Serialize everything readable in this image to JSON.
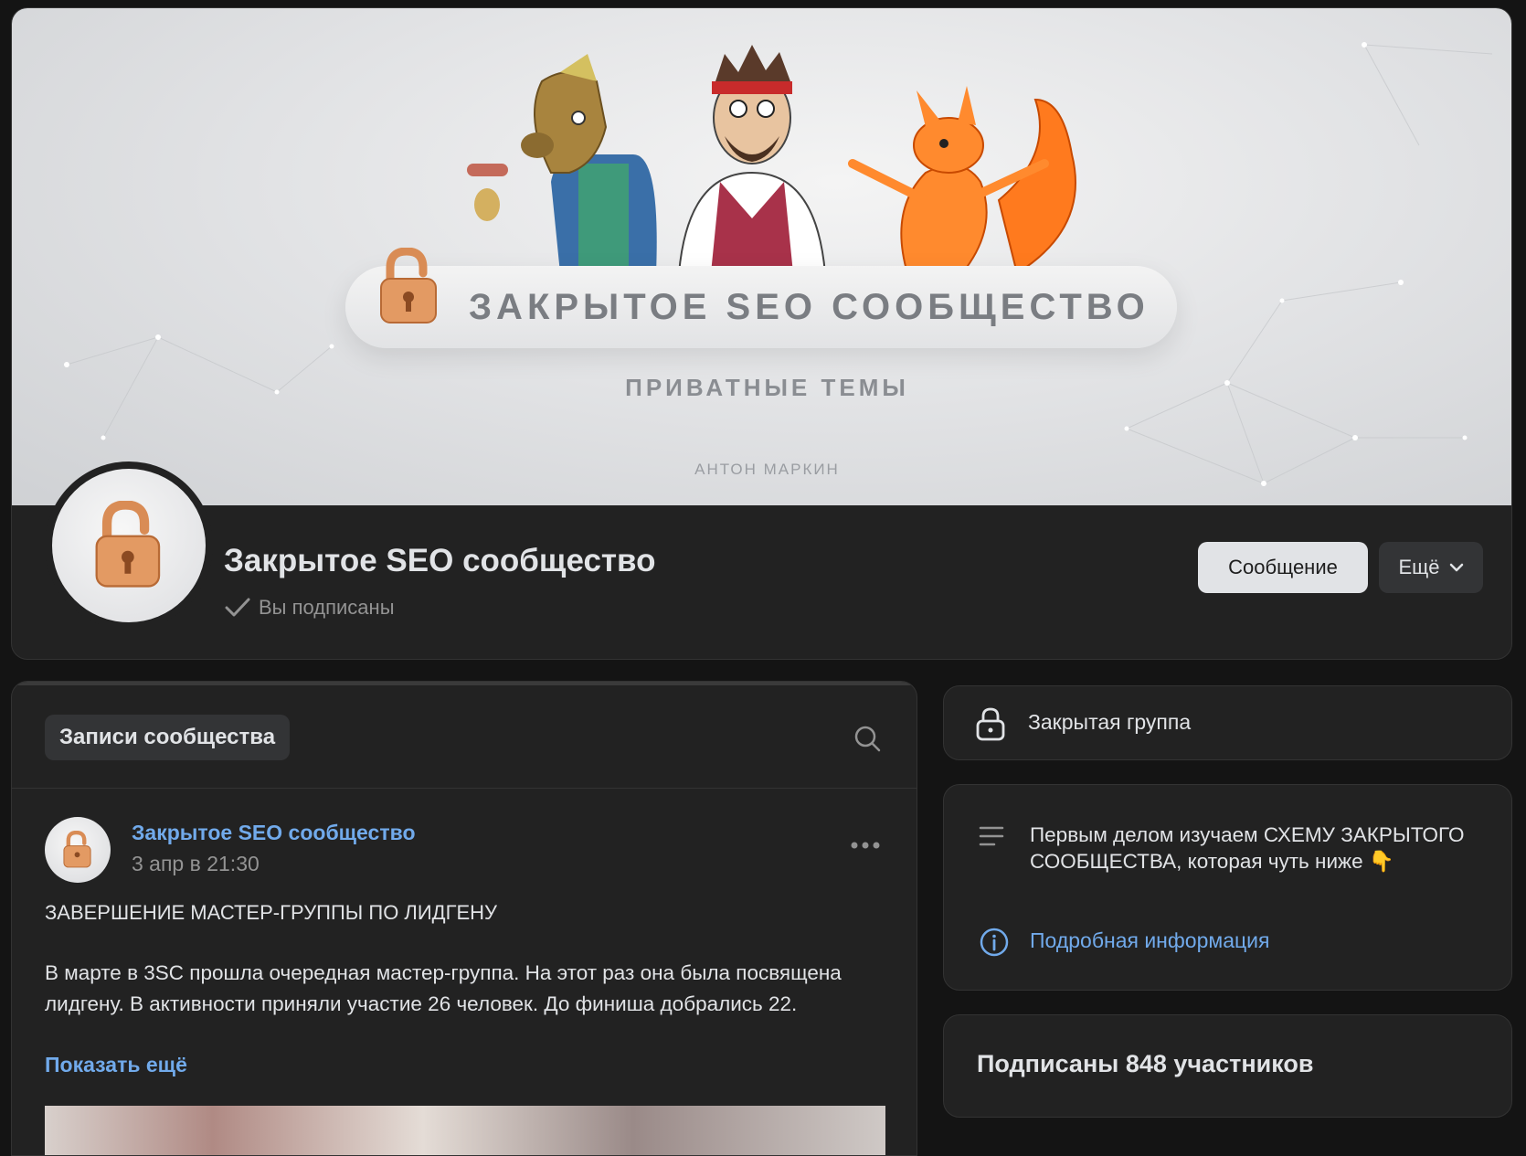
{
  "cover": {
    "title": "ЗАКРЫТОЕ SEO СООБЩЕСТВО",
    "subtitle": "ПРИВАТНЫЕ ТЕМЫ",
    "author": "АНТОН МАРКИН"
  },
  "group": {
    "name": "Закрытое SEO сообщество",
    "status": "Вы подписаны"
  },
  "actions": {
    "message_label": "Сообщение",
    "more_label": "Ещё"
  },
  "feed": {
    "tab_label": "Записи сообщества",
    "post": {
      "author": "Закрытое SEO сообщество",
      "date": "3 апр в 21:30",
      "heading": "ЗАВЕРШЕНИЕ МАСТЕР-ГРУППЫ ПО ЛИДГЕНУ",
      "text": "В марте в 3SC прошла очередная мастер-группа. На этот раз она была посвящена лидгену. В активности приняли участие 26 человек. До финиша добрались 22.",
      "show_more": "Показать ещё"
    }
  },
  "sidebar": {
    "closed_label": "Закрытая группа",
    "description": "Первым делом изучаем СХЕМУ ЗАКРЫТОГО СООБЩЕСТВА, которая чуть ниже 👇",
    "more_info": "Подробная информация",
    "members": "Подписаны 848 участников"
  },
  "colors": {
    "background": "#141414",
    "card": "#222222",
    "link": "#71aaeb",
    "text": "#e1e3e6",
    "muted": "#939393"
  }
}
